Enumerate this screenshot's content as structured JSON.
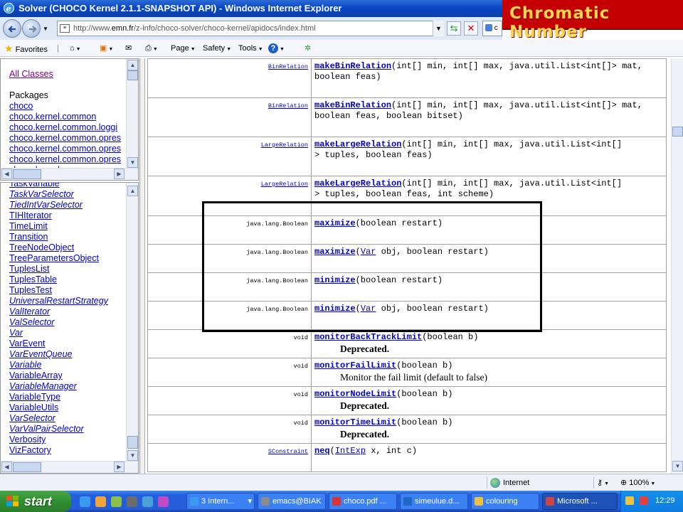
{
  "window": {
    "title": "Solver (CHOCO Kernel 2.1.1-SNAPSHOT API) - Windows Internet Explorer"
  },
  "overlay": {
    "label": "Chromatic Number",
    "colors": [
      "#ffd34d",
      "#c40000"
    ]
  },
  "address": {
    "url_prefix": "http://www.",
    "url_domain": "emn.fr",
    "url_suffix": "/z-info/choco-solver/choco-kernel/apidocs/index.html",
    "search_text": "c"
  },
  "commandbar": {
    "favorites": "Favorites",
    "page": "Page",
    "safety": "Safety",
    "tools": "Tools",
    "help": "?"
  },
  "left_upper": {
    "all_classes": "All Classes",
    "packages_heading": "Packages",
    "packages": [
      "choco",
      "choco.kernel.common",
      "choco.kernel.common.loggi",
      "choco.kernel.common.opres",
      "choco.kernel.common.opres",
      "choco.kernel.common.opres",
      "choco.kernel.common.opres"
    ]
  },
  "left_lower": {
    "classes": [
      {
        "name": "TaskVariable",
        "italic": false
      },
      {
        "name": "TaskVarSelector",
        "italic": true
      },
      {
        "name": "TiedIntVarSelector",
        "italic": true
      },
      {
        "name": "TIHIterator",
        "italic": false
      },
      {
        "name": "TimeLimit",
        "italic": false
      },
      {
        "name": "Transition",
        "italic": false
      },
      {
        "name": "TreeNodeObject",
        "italic": false
      },
      {
        "name": "TreeParametersObject",
        "italic": false
      },
      {
        "name": "TuplesList",
        "italic": false
      },
      {
        "name": "TuplesTable",
        "italic": false
      },
      {
        "name": "TuplesTest",
        "italic": false
      },
      {
        "name": "UniversalRestartStrategy",
        "italic": true
      },
      {
        "name": "ValIterator",
        "italic": true
      },
      {
        "name": "ValSelector",
        "italic": true
      },
      {
        "name": "Var",
        "italic": true
      },
      {
        "name": "VarEvent",
        "italic": false
      },
      {
        "name": "VarEventQueue",
        "italic": true
      },
      {
        "name": "Variable",
        "italic": true
      },
      {
        "name": "VariableArray",
        "italic": false
      },
      {
        "name": "VariableManager",
        "italic": true
      },
      {
        "name": "VariableType",
        "italic": false
      },
      {
        "name": "VariableUtils",
        "italic": false
      },
      {
        "name": "VarSelector",
        "italic": true
      },
      {
        "name": "VarValPairSelector",
        "italic": true
      },
      {
        "name": "Verbosity",
        "italic": false
      },
      {
        "name": "VizFactory",
        "italic": false
      }
    ]
  },
  "methods": [
    {
      "rtype": "BinRelation",
      "rlink": true,
      "name": "makeBinRelation",
      "sig": [
        {
          "t": "(int[] min, int[] max, java.util.List<int[]> mat,"
        },
        {
          "t": "boolean feas)"
        }
      ],
      "desc": ""
    },
    {
      "rtype": "BinRelation",
      "rlink": true,
      "name": "makeBinRelation",
      "sig": [
        {
          "t": "(int[] min, int[] max, java.util.List<int[]> mat,"
        },
        {
          "t": "boolean feas, boolean bitset)"
        }
      ],
      "desc": ""
    },
    {
      "rtype": "LargeRelation",
      "rlink": true,
      "name": "makeLargeRelation",
      "sig": [
        {
          "t": "(int[] min, int[] max, java.util.List<int[]"
        },
        {
          "t": "> tuples, boolean feas)"
        }
      ],
      "desc": ""
    },
    {
      "rtype": "LargeRelation",
      "rlink": true,
      "name": "makeLargeRelation",
      "sig": [
        {
          "t": "(int[] min, int[] max, java.util.List<int[]"
        },
        {
          "t": "> tuples, boolean feas, int scheme)"
        }
      ],
      "desc": ""
    },
    {
      "rtype": "java.lang.Boolean",
      "rlink": false,
      "name": "maximize",
      "sig": [
        {
          "t": "(boolean restart)"
        }
      ],
      "desc": ""
    },
    {
      "rtype": "java.lang.Boolean",
      "rlink": false,
      "name": "maximize",
      "sig": [
        {
          "t": "(",
          "link": "Var",
          "after": " obj, boolean restart)"
        }
      ],
      "desc": ""
    },
    {
      "rtype": "java.lang.Boolean",
      "rlink": false,
      "name": "minimize",
      "sig": [
        {
          "t": "(boolean restart)"
        }
      ],
      "desc": ""
    },
    {
      "rtype": "java.lang.Boolean",
      "rlink": false,
      "name": "minimize",
      "sig": [
        {
          "t": "(",
          "link": "Var",
          "after": " obj, boolean restart)"
        }
      ],
      "desc": ""
    },
    {
      "rtype": "void",
      "rlink": false,
      "name": "monitorBackTrackLimit",
      "sig": [
        {
          "t": "(boolean b)"
        }
      ],
      "desc": "Deprecated.",
      "bold": true
    },
    {
      "rtype": "void",
      "rlink": false,
      "name": "monitorFailLimit",
      "sig": [
        {
          "t": "(boolean b)"
        }
      ],
      "desc": "Monitor the fail limit (default to false)",
      "bold": false
    },
    {
      "rtype": "void",
      "rlink": false,
      "name": "monitorNodeLimit",
      "sig": [
        {
          "t": "(boolean b)"
        }
      ],
      "desc": "Deprecated.",
      "bold": true
    },
    {
      "rtype": "void",
      "rlink": false,
      "name": "monitorTimeLimit",
      "sig": [
        {
          "t": "(boolean b)"
        }
      ],
      "desc": "Deprecated.",
      "bold": true
    },
    {
      "rtype": "SConstraint",
      "rlink": true,
      "name": "neq",
      "sig": [
        {
          "t": "(",
          "link": "IntExp",
          "after": " x, int c)"
        }
      ],
      "desc": ""
    }
  ],
  "status": {
    "zone": "Internet",
    "zoom": "100%"
  },
  "taskbar": {
    "start": "start",
    "tasks": [
      "3 Intern...",
      "emacs@BIAK",
      "choco.pdf ...",
      "simeulue.d...",
      "colouring",
      "Microsoft ..."
    ],
    "clock": "12:29"
  }
}
